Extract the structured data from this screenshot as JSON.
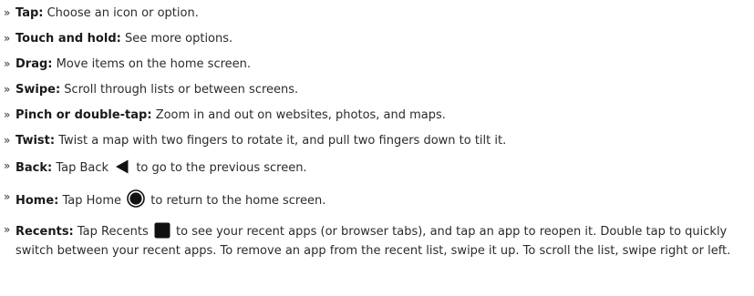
{
  "bullet_glyph": "»",
  "items": [
    {
      "term": "Tap:",
      "text": " Choose an icon or option."
    },
    {
      "term": "Touch and hold:",
      "text": " See more options."
    },
    {
      "term": "Drag:",
      "text": " Move items on the home screen."
    },
    {
      "term": "Swipe:",
      "text": " Scroll through lists or between screens."
    },
    {
      "term": "Pinch or double-tap:",
      "text": " Zoom in and out on websites, photos, and maps."
    },
    {
      "term": "Twist:",
      "text": " Twist a map with two fingers to rotate it, and pull two fingers down to tilt it."
    },
    {
      "term": "Back:",
      "text_before": " Tap Back ",
      "icon": "back-triangle-icon",
      "text_after": " to go to the previous screen."
    },
    {
      "term": "Home:",
      "text_before": " Tap Home ",
      "icon": "home-circle-icon",
      "text_after": " to return to the home screen."
    },
    {
      "term": "Recents:",
      "text_before": " Tap Recents ",
      "icon": "recents-square-icon",
      "text_after": " to see your recent apps (or browser tabs), and tap an app to reopen it. Double tap to quickly switch between your recent apps. To remove an app from the recent list, swipe it up. To scroll the list, swipe right or left."
    }
  ],
  "icon_color": "#111111"
}
